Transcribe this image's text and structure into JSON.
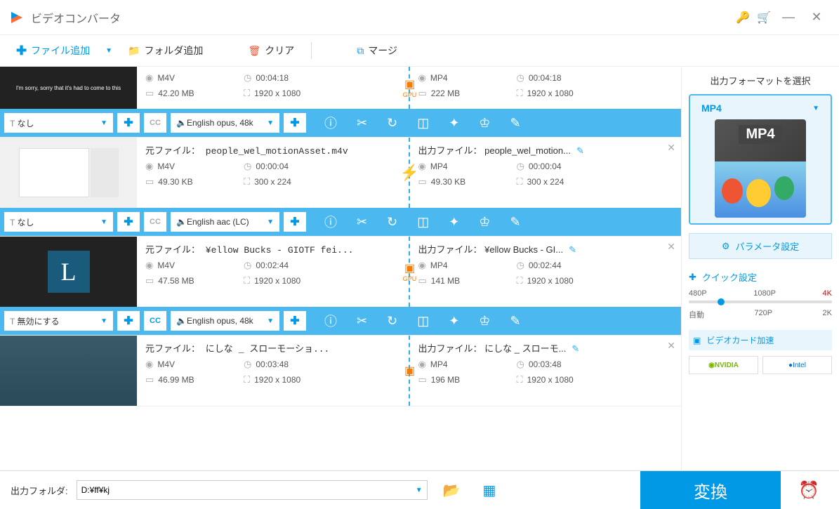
{
  "app": {
    "title": "ビデオコンバータ"
  },
  "toolbar": {
    "add_file": "ファイル追加",
    "add_folder": "フォルダ追加",
    "clear": "クリア",
    "merge": "マージ"
  },
  "files": [
    {
      "src_fmt": "M4V",
      "src_dur": "00:04:18",
      "src_size": "42.20 MB",
      "src_dim": "1920 x 1080",
      "out_fmt": "MP4",
      "out_dur": "00:04:18",
      "out_size": "222 MB",
      "out_dim": "1920 x 1080",
      "gpu": "GPU",
      "subtitle": "なし",
      "audio": "English opus, 48k"
    },
    {
      "src_name": "元ファイル： people_wel_motionAsset.m4v",
      "out_name": "出力ファイル： people_wel_motion...",
      "src_fmt": "M4V",
      "src_dur": "00:00:04",
      "src_size": "49.30 KB",
      "src_dim": "300 x 224",
      "out_fmt": "MP4",
      "out_dur": "00:00:04",
      "out_size": "49.30 KB",
      "out_dim": "300 x 224",
      "bolt": true,
      "subtitle": "なし",
      "audio": "English aac (LC)"
    },
    {
      "src_name": "元ファイル： ¥ellow Bucks - GIOTF fei...",
      "out_name": "出力ファイル： ¥ellow Bucks - GI...",
      "src_fmt": "M4V",
      "src_dur": "00:02:44",
      "src_size": "47.58 MB",
      "src_dim": "1920 x 1080",
      "out_fmt": "MP4",
      "out_dur": "00:02:44",
      "out_size": "141 MB",
      "out_dim": "1920 x 1080",
      "gpu": "GPU",
      "subtitle": "無効にする",
      "audio": "English opus, 48k"
    },
    {
      "src_name": "元ファイル： にしな _ スローモーショ...",
      "out_name": "出力ファイル： にしな _ スローモ...",
      "src_fmt": "M4V",
      "src_dur": "00:03:48",
      "src_size": "46.99 MB",
      "src_dim": "1920 x 1080",
      "out_fmt": "MP4",
      "out_dur": "00:03:48",
      "out_size": "196 MB",
      "out_dim": "1920 x 1080",
      "gpu": true
    }
  ],
  "sidebar": {
    "title": "出力フォーマットを選択",
    "format": "MP4",
    "format_label": "MP4",
    "param_settings": "パラメータ設定",
    "quick_settings": "クイック設定",
    "res_labels": [
      "480P",
      "1080P",
      "4K"
    ],
    "quality_labels": [
      "自動",
      "720P",
      "2K"
    ],
    "gpu_accel": "ビデオカード加速",
    "gpu_vendors": [
      "NVIDIA",
      "Intel"
    ]
  },
  "footer": {
    "output_folder_label": "出力フォルダ:",
    "output_path": "D:¥ff¥kj",
    "convert": "変換"
  }
}
